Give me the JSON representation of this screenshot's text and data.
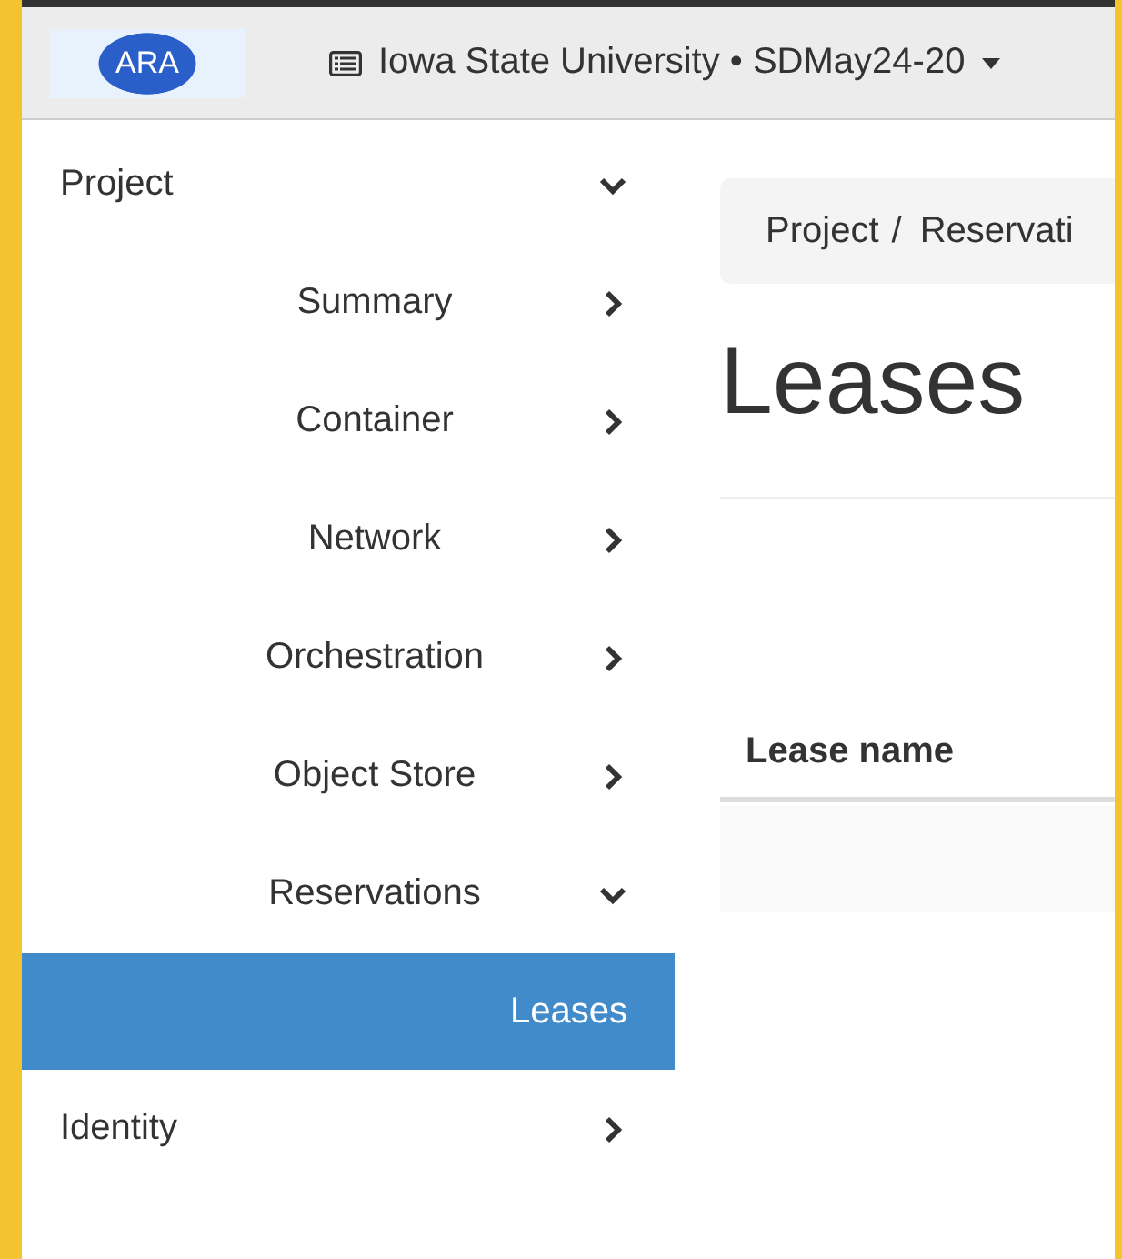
{
  "header": {
    "org": "Iowa State University • SDMay24-20",
    "logo": "ARA"
  },
  "sidebar": {
    "items": [
      {
        "label": "Project",
        "expanded": true,
        "children": [
          {
            "label": "Summary",
            "expanded": false
          },
          {
            "label": "Container",
            "expanded": false
          },
          {
            "label": "Network",
            "expanded": false
          },
          {
            "label": "Orchestration",
            "expanded": false
          },
          {
            "label": "Object Store",
            "expanded": false
          },
          {
            "label": "Reservations",
            "expanded": true,
            "children": [
              {
                "label": "Leases",
                "selected": true
              }
            ]
          }
        ]
      },
      {
        "label": "Identity",
        "expanded": false
      }
    ]
  },
  "breadcrumb": {
    "separator": "/",
    "items": [
      "Project",
      "Reservati"
    ]
  },
  "page_title": "Leases",
  "table": {
    "columns": [
      "Lease name"
    ]
  }
}
